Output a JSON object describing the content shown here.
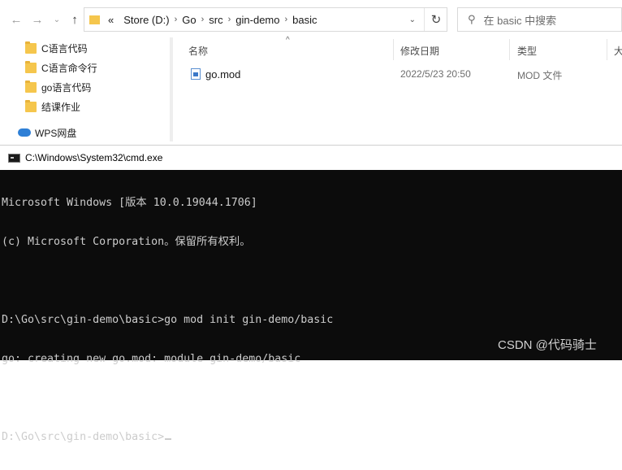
{
  "explorer": {
    "address": {
      "overflow": "«",
      "segments": [
        "Store (D:)",
        "Go",
        "src",
        "gin-demo",
        "basic"
      ]
    },
    "search_placeholder": "在 basic 中搜索",
    "sidebar": {
      "items": [
        {
          "label": "C语言代码",
          "icon": "folder-icon"
        },
        {
          "label": "C语言命令行",
          "icon": "folder-icon"
        },
        {
          "label": "go语言代码",
          "icon": "folder-icon"
        },
        {
          "label": "结课作业",
          "icon": "folder-icon"
        }
      ],
      "wps": {
        "label": "WPS网盘",
        "icon": "cloud-icon"
      }
    },
    "columns": {
      "name": "名称",
      "modified": "修改日期",
      "type": "类型",
      "size": "大"
    },
    "files": [
      {
        "name": "go.mod",
        "modified": "2022/5/23 20:50",
        "type": "MOD 文件"
      }
    ]
  },
  "cmd": {
    "title": "C:\\Windows\\System32\\cmd.exe",
    "lines": [
      "Microsoft Windows [版本 10.0.19044.1706]",
      "(c) Microsoft Corporation。保留所有权利。",
      "",
      "D:\\Go\\src\\gin-demo\\basic>go mod init gin-demo/basic",
      "go: creating new go.mod: module gin-demo/basic",
      "",
      "D:\\Go\\src\\gin-demo\\basic>"
    ]
  },
  "watermark": "CSDN @代码骑士"
}
